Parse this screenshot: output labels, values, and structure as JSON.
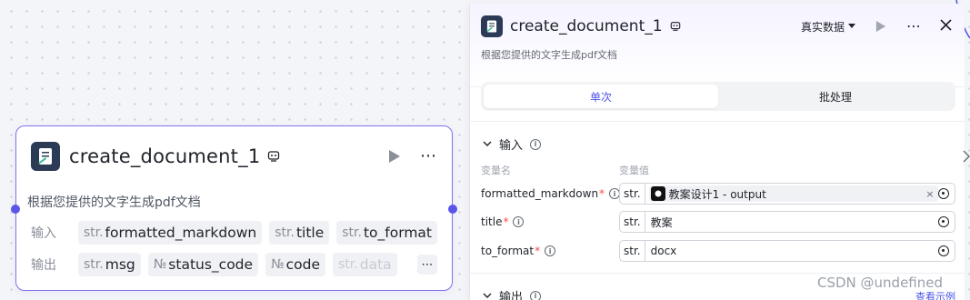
{
  "node": {
    "title": "create_document_1",
    "description": "根据您提供的文字生成pdf文档",
    "input_label": "输入",
    "output_label": "输出",
    "inputs": [
      {
        "type": "str.",
        "name": "formatted_markdown"
      },
      {
        "type": "str.",
        "name": "title"
      },
      {
        "type": "str.",
        "name": "to_format"
      }
    ],
    "outputs": [
      {
        "type": "str.",
        "name": "msg"
      },
      {
        "type": "№",
        "name": "status_code"
      },
      {
        "type": "№",
        "name": "code"
      },
      {
        "type": "str.",
        "name": "data"
      }
    ],
    "more": "⋯"
  },
  "panel": {
    "title": "create_document_1",
    "description": "根据您提供的文字生成pdf文档",
    "data_mode": "真实数据",
    "tabs": [
      {
        "label": "单次",
        "active": true
      },
      {
        "label": "批处理",
        "active": false
      }
    ],
    "input_section": "输入",
    "output_section": "输出",
    "col_name": "变量名",
    "col_value": "变量值",
    "params": [
      {
        "label": "formatted_markdown",
        "required": "*",
        "type": "str.",
        "ref": "教案设计1 - output"
      },
      {
        "label": "title",
        "required": "*",
        "type": "str.",
        "value": "教案"
      },
      {
        "label": "to_format",
        "required": "*",
        "type": "str.",
        "value": "docx"
      }
    ],
    "sample_link": "查看示例"
  },
  "watermark": "CSDN @undefined",
  "colors": {
    "accent": "#4d53e8",
    "node_border": "#7f72f0",
    "required": "#f54a45"
  }
}
